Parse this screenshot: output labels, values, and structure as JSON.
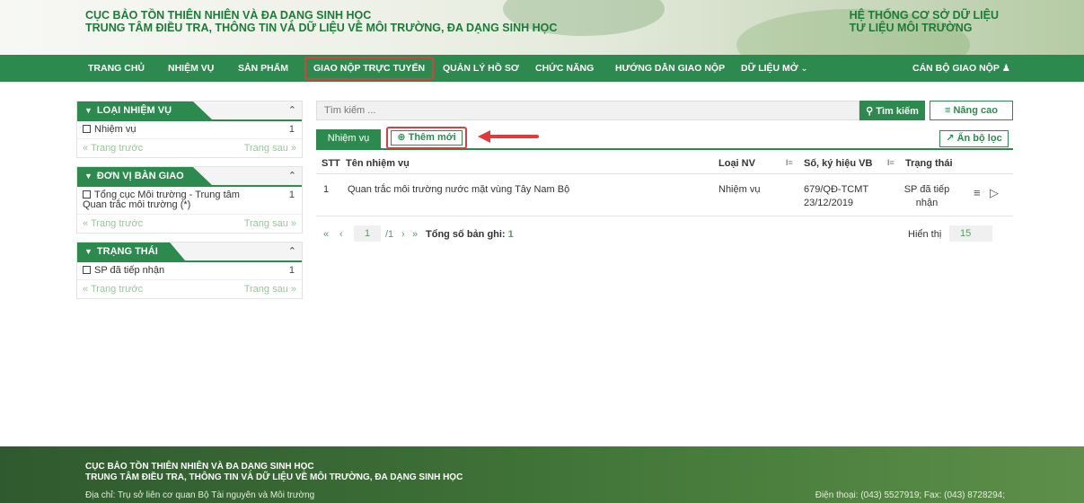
{
  "header": {
    "org_line1": "CỤC BẢO TỒN THIÊN NHIÊN VÀ ĐA DẠNG SINH HỌC",
    "org_line2": "TRUNG TÂM ĐIỀU TRA, THÔNG TIN VÀ DỮ LIỆU VỀ MÔI TRƯỜNG, ĐA DẠNG SINH HỌC",
    "sys_line1": "HỆ THỐNG CƠ SỞ DỮ LIỆU",
    "sys_line2": "TƯ LIỆU MÔI TRƯỜNG"
  },
  "nav": {
    "items": [
      {
        "label": "TRANG CHỦ"
      },
      {
        "label": "NHIỆM VỤ"
      },
      {
        "label": "SẢN PHẨM"
      },
      {
        "label": "GIAO NỘP TRỰC TUYẾN",
        "active": true
      },
      {
        "label": "QUẢN LÝ HỒ SƠ"
      },
      {
        "label": "CHỨC NĂNG"
      },
      {
        "label": "HƯỚNG DẪN GIAO NỘP"
      },
      {
        "label": "DỮ LIỆU MỞ"
      }
    ],
    "user": "CÁN BỘ GIAO NỘP"
  },
  "sidebar": {
    "panels": [
      {
        "title": "LOẠI NHIỆM VỤ",
        "rows": [
          {
            "label": "Nhiệm vụ",
            "count": "1"
          }
        ],
        "prev": "« Trang trước",
        "next": "Trang sau »"
      },
      {
        "title": "ĐƠN VỊ BÀN GIAO",
        "rows": [
          {
            "label": "Tổng cục Môi trường - Trung tâm Quan trắc môi trường (*)",
            "count": "1"
          }
        ],
        "prev": "« Trang trước",
        "next": "Trang sau »"
      },
      {
        "title": "TRẠNG THÁI",
        "rows": [
          {
            "label": "SP đã tiếp nhận",
            "count": "1"
          }
        ],
        "prev": "« Trang trước",
        "next": "Trang sau »"
      }
    ]
  },
  "main": {
    "search_placeholder": "Tìm kiếm ...",
    "search_btn": "Tìm kiếm",
    "advanced_btn": "Nâng cao",
    "tab_label": "Nhiệm vụ",
    "add_btn": "Thêm mới",
    "hide_filter_btn": "Ẩn bộ lọc",
    "columns": {
      "stt": "STT",
      "name": "Tên nhiệm vụ",
      "type": "Loại NV",
      "doc": "Số, ký hiệu VB",
      "status": "Trạng thái"
    },
    "rows": [
      {
        "stt": "1",
        "name": "Quan trắc môi trường nước mặt vùng Tây Nam Bộ",
        "type": "Nhiệm vụ",
        "doc_no": "679/QĐ-TCMT",
        "doc_date": "23/12/2019",
        "status_line1": "SP đã tiếp",
        "status_line2": "nhận"
      }
    ],
    "pager": {
      "first": "«",
      "prev": "‹",
      "page": "1",
      "of": "/1",
      "next": "›",
      "last": "»",
      "total_label": "Tổng số bản ghi:",
      "total": "1",
      "show_label": "Hiển thị",
      "show_value": "15"
    }
  },
  "footer": {
    "line1": "CỤC BẢO TỒN THIÊN NHIÊN VÀ ĐA DẠNG SINH HỌC",
    "line2": "TRUNG TÂM ĐIỀU TRA, THÔNG TIN VÀ DỮ LIỆU VỀ MÔI TRƯỜNG, ĐA DẠNG SINH HỌC",
    "address": "Địa chỉ: Trụ sở liên cơ quan Bộ Tài nguyên và Môi trường",
    "phone": "Điện thoại: (043) 5527919; Fax: (043) 8728294;"
  },
  "colors": {
    "primary": "#2d8a4f",
    "highlight": "#d94040"
  }
}
